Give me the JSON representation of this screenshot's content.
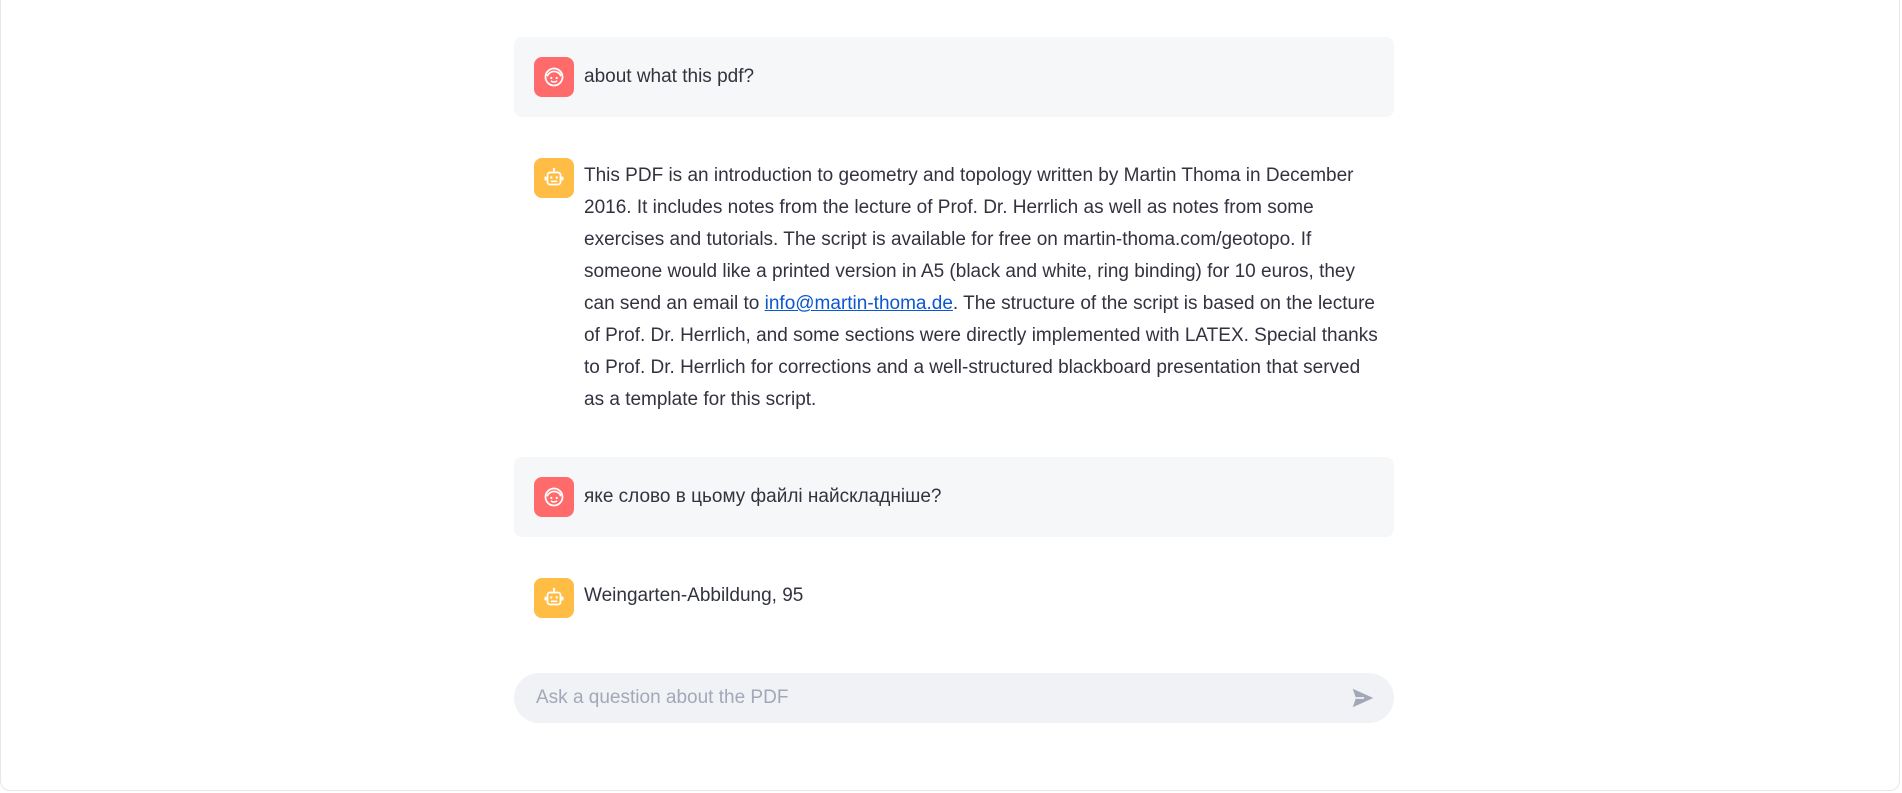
{
  "colors": {
    "user_avatar": "#ff6b6b",
    "assistant_avatar": "#ffbd45",
    "user_bubble": "#f6f7f9",
    "input_bg": "#f0f2f6",
    "link": "#0b57d0"
  },
  "messages": [
    {
      "role": "user",
      "avatar_icon": "user-face-icon",
      "text": "about what this pdf?"
    },
    {
      "role": "assistant",
      "avatar_icon": "robot-icon",
      "text_before_link": "This PDF is an introduction to geometry and topology written by Martin Thoma in December 2016. It includes notes from the lecture of Prof. Dr. Herrlich as well as notes from some exercises and tutorials. The script is available for free on martin-thoma.com/geotopo. If someone would like a printed version in A5 (black and white, ring binding) for 10 euros, they can send an email to ",
      "link_text": "info@martin-thoma.de",
      "text_after_link": ". The structure of the script is based on the lecture of Prof. Dr. Herrlich, and some sections were directly implemented with LATEX. Special thanks to Prof. Dr. Herrlich for corrections and a well-structured blackboard presentation that served as a template for this script."
    },
    {
      "role": "user",
      "avatar_icon": "user-face-icon",
      "text": "яке слово в цьому файлі найскладніше?"
    },
    {
      "role": "assistant",
      "avatar_icon": "robot-icon",
      "text": "Weingarten-Abbildung, 95"
    }
  ],
  "chat_input": {
    "placeholder": "Ask a question about the PDF",
    "value": "",
    "send_icon": "send-icon"
  }
}
